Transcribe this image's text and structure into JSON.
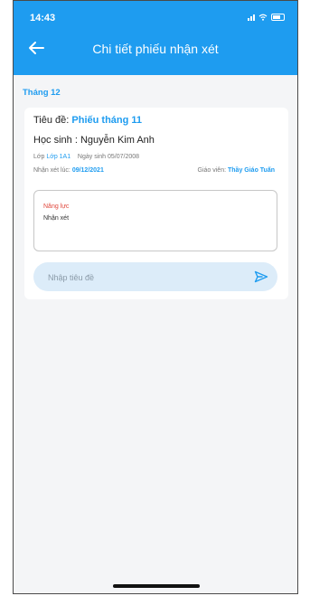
{
  "status_bar": {
    "time": "14:43"
  },
  "header": {
    "title": "Chi tiết phiếu nhận xét"
  },
  "month": "Tháng 12",
  "card": {
    "title_label": "Tiêu đề:",
    "title_value": "Phiếu tháng 11",
    "student_label": "Học sinh :",
    "student_name": "Nguyễn Kim Anh",
    "class_label": "Lớp",
    "class_value": "Lớp 1A1",
    "birth_label": "Ngày sinh",
    "birth_value": "05/07/2008",
    "commented_at_label": "Nhận xét lúc:",
    "commented_at_value": "09/12/2021",
    "teacher_label": "Giáo viên:",
    "teacher_value": "Thầy Giáo Tuấn",
    "comment_category": "Năng lực",
    "comment_text": "Nhận xét"
  },
  "input": {
    "placeholder": "Nhập tiêu đề"
  },
  "colors": {
    "primary": "#1e9cf0",
    "accent_red": "#e0473b",
    "input_bg": "#dcecf9"
  },
  "icons": {
    "back": "arrow-left-icon",
    "send": "send-icon"
  }
}
